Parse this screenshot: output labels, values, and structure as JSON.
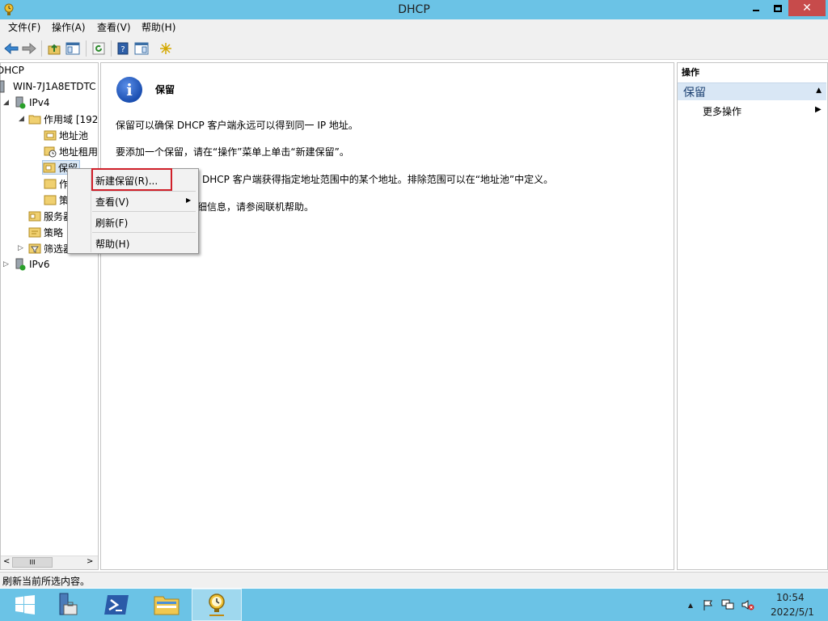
{
  "window": {
    "title": "DHCP"
  },
  "menu": [
    "文件(F)",
    "操作(A)",
    "查看(V)",
    "帮助(H)"
  ],
  "tree": {
    "root": "DHCP",
    "server": "WIN-7J1A8ETDTC",
    "ipv4": "IPv4",
    "scope": "作用域 [192",
    "address_pool": "地址池",
    "address_leases": "地址租用",
    "reservations": "保留",
    "scope_options": "作",
    "policies_sub": "策",
    "server_options": "服务器",
    "policies": "策略",
    "filters": "筛选器",
    "ipv6": "IPv6"
  },
  "content": {
    "heading": "保留",
    "line1": "保留可以确保 DHCP 客户端永远可以得到同一 IP 地址。",
    "line2": "要添加一个保留，请在“操作”菜单上单击“新建保留”。",
    "line3": "DHCP 客户端获得指定地址范围中的某个地址。排除范围可以在“地址池”中定义。",
    "line4": "详细信息，请参阅联机帮助。"
  },
  "actions": {
    "title": "操作",
    "group": "保留",
    "more": "更多操作"
  },
  "context_menu": {
    "new_reservation": "新建保留(R)...",
    "view": "查看(V)",
    "refresh": "刷新(F)",
    "help": "帮助(H)"
  },
  "status": "刷新当前所选内容。",
  "clock": {
    "time": "10:54",
    "date": "2022/5/1"
  },
  "colors": {
    "titlebar": "#6bc3e6",
    "taskbar": "#6bc3e6",
    "highlight_box": "#d0202a",
    "actions_group": "#d9e7f5"
  }
}
